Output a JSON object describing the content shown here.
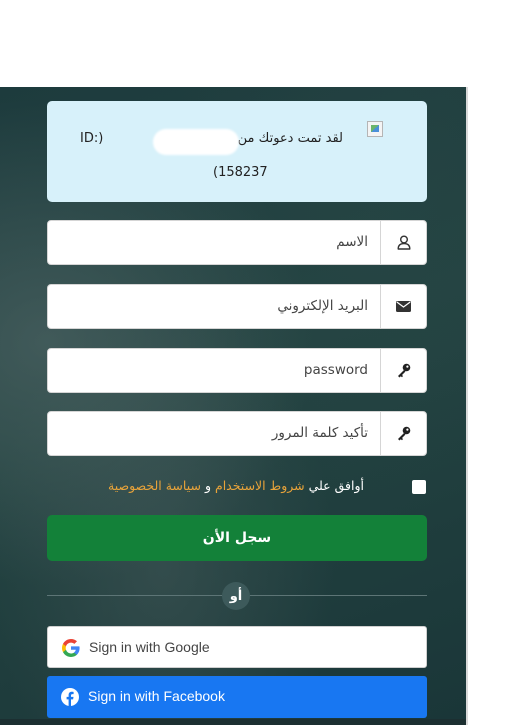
{
  "invite": {
    "message": "لقد تمت دعوتك من قبل",
    "id_prefix": "ID:)",
    "id_suffix": "(158237"
  },
  "form": {
    "name_placeholder": "الاسم",
    "email_placeholder": "البريد الإلكتروني",
    "password_placeholder": "password",
    "confirm_placeholder": "تأكيد كلمة المرور"
  },
  "agreement": {
    "text": "أوافق علي",
    "terms_link": "شروط الاستخدام",
    "conjunction": "و",
    "privacy_link": "سياسة الخصوصية"
  },
  "register_button": "سجل الأن",
  "or_label": "أو",
  "social": {
    "google_label": "Sign in with Google",
    "facebook_label": "Sign in with Facebook"
  },
  "colors": {
    "primary_green": "#138139",
    "link_orange": "#e8a33a",
    "facebook_blue": "#1877f2",
    "invite_bg": "#d7f1fa"
  },
  "icons": {
    "name": "user-icon",
    "email": "envelope-icon",
    "password": "key-icon",
    "confirm": "key-icon",
    "google": "google-icon",
    "facebook": "facebook-icon"
  }
}
